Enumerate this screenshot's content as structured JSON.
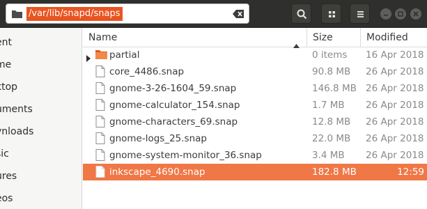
{
  "pathbar": {
    "path": "/var/lib/snapd/snaps"
  },
  "sidebar": {
    "items": [
      "ent",
      "me",
      "ktop",
      "uments",
      "vnloads",
      "sic",
      "ures",
      "eos"
    ]
  },
  "columns": {
    "name": "Name",
    "size": "Size",
    "modified": "Modified"
  },
  "rows": [
    {
      "name": "partial",
      "size": "0 items",
      "modified": "16 Apr 2018",
      "type": "folder"
    },
    {
      "name": "core_4486.snap",
      "size": "90.8 MB",
      "modified": "26 Apr 2018",
      "type": "file"
    },
    {
      "name": "gnome-3-26-1604_59.snap",
      "size": "146.8 MB",
      "modified": "26 Apr 2018",
      "type": "file"
    },
    {
      "name": "gnome-calculator_154.snap",
      "size": "1.7 MB",
      "modified": "26 Apr 2018",
      "type": "file"
    },
    {
      "name": "gnome-characters_69.snap",
      "size": "12.8 MB",
      "modified": "26 Apr 2018",
      "type": "file"
    },
    {
      "name": "gnome-logs_25.snap",
      "size": "22.0 MB",
      "modified": "26 Apr 2018",
      "type": "file"
    },
    {
      "name": "gnome-system-monitor_36.snap",
      "size": "3.4 MB",
      "modified": "26 Apr 2018",
      "type": "file"
    },
    {
      "name": "inkscape_4690.snap",
      "size": "182.8 MB",
      "modified": "12:59",
      "type": "file",
      "selected": true
    }
  ],
  "colors": {
    "accent": "#e95420",
    "selection": "#f07746",
    "header": "#2f2f2d"
  }
}
